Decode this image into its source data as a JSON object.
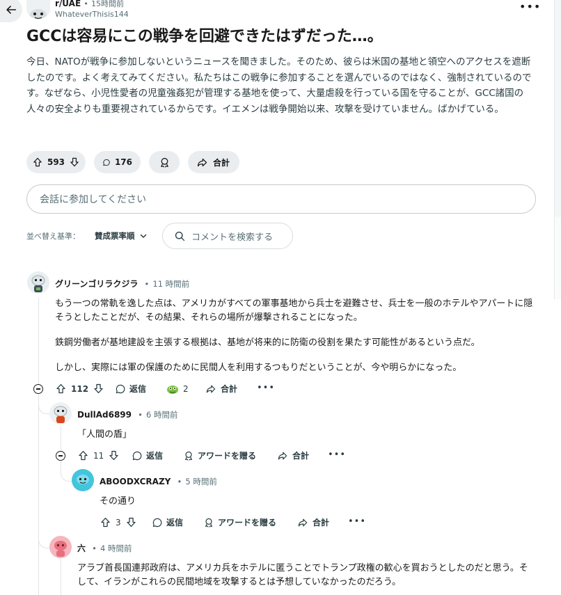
{
  "post": {
    "subreddit": "r/UAE",
    "time": "15時間前",
    "username": "WhateverThisis144",
    "title": "GCCは容易にこの戦争を回避できたはずだった…。",
    "body": "今日、NATOが戦争に参加しないというニュースを聞きました。そのため、彼らは米国の基地と領空へのアクセスを遮断したのです。よく考えてみてください。私たちはこの戦争に参加することを選んでいるのではなく、強制されているのです。なぜなら、小児性愛者の児童強姦犯が管理する基地を使って、大量虐殺を行っている国を守ることが、GCC諸国の人々の安全よりも重要視されているからです。イエメンは戦争開始以来、攻撃を受けていません。ばかげている。",
    "votes": "593",
    "comments": "176",
    "share_label": "合計"
  },
  "comment_box": {
    "placeholder": "会話に参加してください"
  },
  "sort": {
    "label": "並べ替え基準：",
    "value": "賛成票率順",
    "search_placeholder": "コメントを検索する"
  },
  "comments": [
    {
      "author": "グリーンゴリラクジラ",
      "time": "11 時間前",
      "paragraphs": [
        "もう一つの常軌を逸した点は、アメリカがすべての軍事基地から兵士を避難させ、兵士を一般のホテルやアパートに隠そうとしたことだが、その結果、それらの場所が爆撃されることになった。",
        "鉄鋼労働者が基地建設を主張する根拠は、基地が将来的に防衛の役割を果たす可能性があるという点だ。",
        "しかし、実際には軍の保護のために民間人を利用するつもりだということが、今や明らかになった。"
      ],
      "votes": "112",
      "reply": "返信",
      "awards": "2",
      "share": "合計"
    },
    {
      "author": "DullAd6899",
      "time": "6 時間前",
      "text": "「人間の盾」",
      "votes": "11",
      "reply": "返信",
      "award": "アワードを贈る",
      "share": "合計"
    },
    {
      "author": "ABOODXCRAZY",
      "time": "5 時間前",
      "text": "その通り",
      "votes": "3",
      "reply": "返信",
      "award": "アワードを贈る",
      "share": "合計"
    },
    {
      "author": "六",
      "time": "4 時間前",
      "text": "アラブ首長国連邦政府は、アメリカ兵をホテルに匿うことでトランプ政権の歓心を買おうとしたのだと思う。そして、イランがこれらの民間地域を攻撃するとは予想していなかったのだろう。"
    }
  ],
  "dot_sep": "•",
  "more": "•••",
  "colors": {
    "accent": "#1a1a1b",
    "muted": "#576f76",
    "pill_bg": "#eaedef",
    "thread": "#dfe3e5"
  }
}
